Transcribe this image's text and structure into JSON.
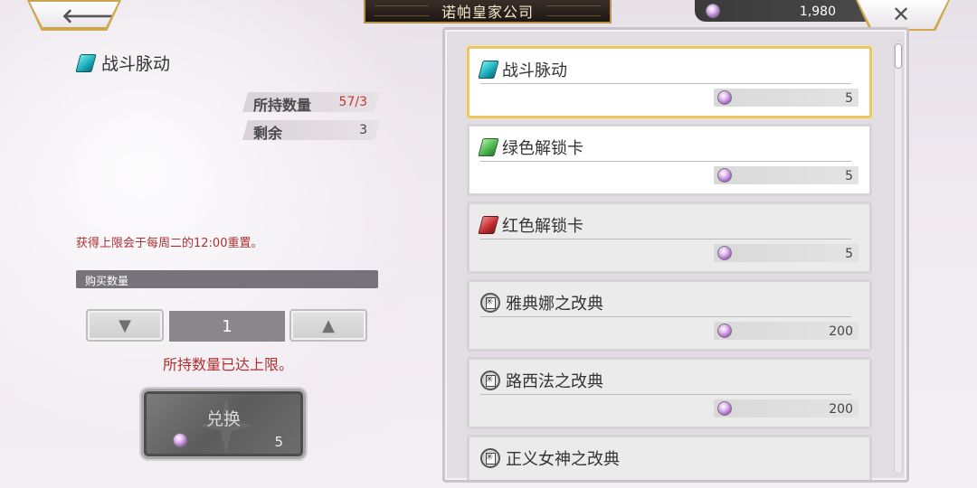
{
  "header": {
    "title": "诺帕皇家公司",
    "back_icon": "back-arrow-icon",
    "close_icon": "close-icon",
    "currency": {
      "icon": "gem-icon",
      "amount": "1,980"
    }
  },
  "detail": {
    "item_name": "战斗脉动",
    "item_icon": "cyan-card-icon",
    "owned_label": "所持数量",
    "owned_value": "57/3",
    "remaining_label": "剩余",
    "remaining_value": "3",
    "reset_note": "获得上限会于每周二的12:00重置。",
    "quantity_header": "购买数量",
    "quantity_value": "1",
    "limit_note": "所持数量已达上限。",
    "exchange_label": "兑换",
    "exchange_cost": "5"
  },
  "shop": {
    "items": [
      {
        "name": "战斗脉动",
        "icon": "cyan-card-icon",
        "price": "5",
        "selected": true
      },
      {
        "name": "绿色解锁卡",
        "icon": "green-card-icon",
        "price": "5"
      },
      {
        "name": "红色解锁卡",
        "icon": "red-card-icon",
        "price": "5"
      },
      {
        "name": "雅典娜之改典",
        "icon": "book-icon",
        "price": "200"
      },
      {
        "name": "路西法之改典",
        "icon": "book-icon",
        "price": "200"
      },
      {
        "name": "正义女神之改典",
        "icon": "book-icon",
        "price": ""
      }
    ]
  },
  "colors": {
    "warning_red": "#b03030",
    "owned_red": "#c0392b",
    "selected_gold": "#e6c56b",
    "title_plate": "#1e1714"
  }
}
